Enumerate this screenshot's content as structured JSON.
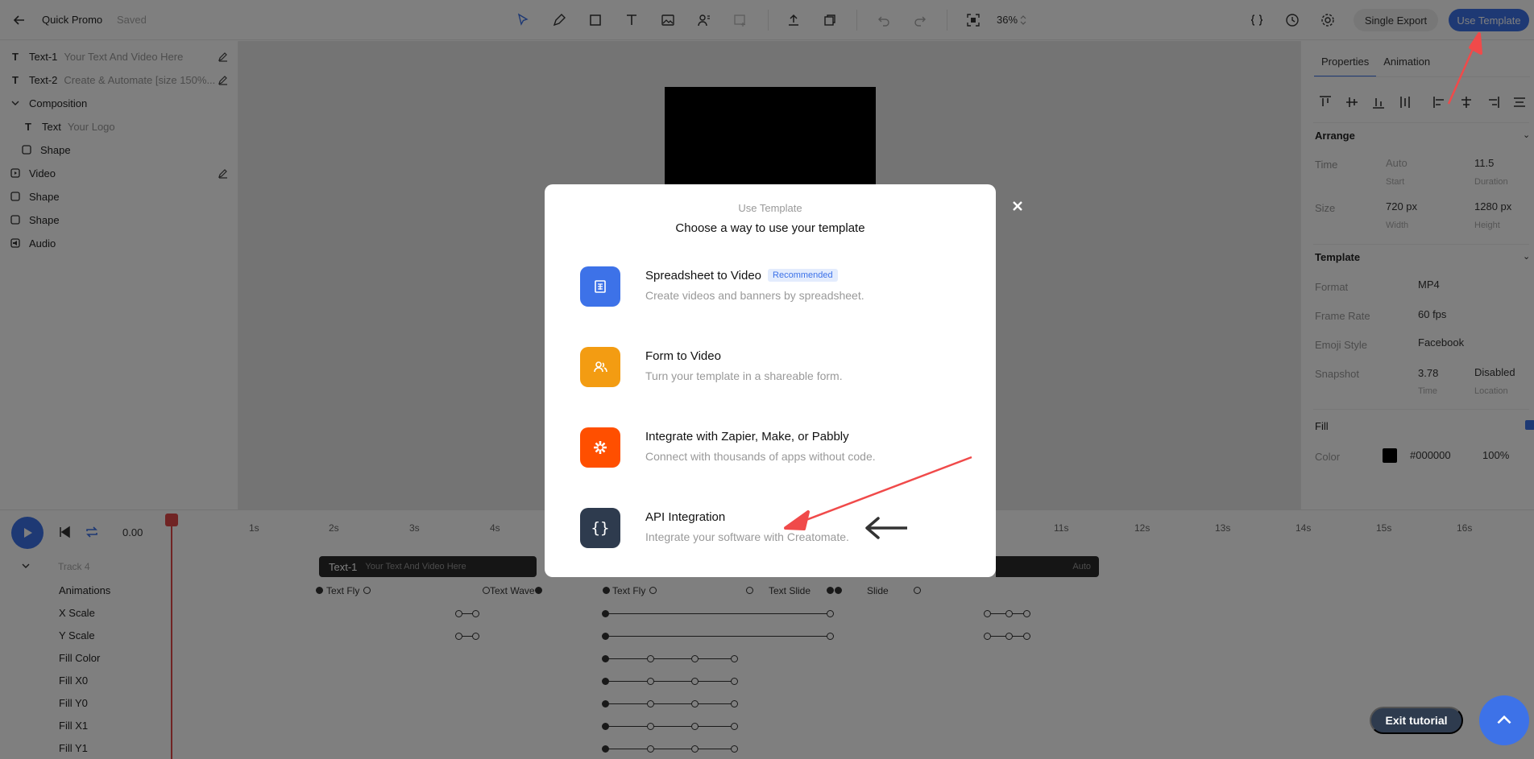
{
  "topbar": {
    "project_name": "Quick Promo",
    "saved_status": "Saved",
    "zoom": "36%",
    "single_export": "Single Export",
    "use_template": "Use Template"
  },
  "layers": [
    {
      "label": "Text-1",
      "sub": "Your Text And Video Here"
    },
    {
      "label": "Text-2",
      "sub": "Create & Automate [size 150%..."
    },
    {
      "label": "Composition",
      "sub": ""
    },
    {
      "label": "Text",
      "sub": "Your Logo"
    },
    {
      "label": "Shape",
      "sub": ""
    },
    {
      "label": "Video",
      "sub": ""
    },
    {
      "label": "Shape",
      "sub": ""
    },
    {
      "label": "Shape",
      "sub": ""
    },
    {
      "label": "Audio",
      "sub": ""
    }
  ],
  "properties": {
    "tabs": [
      "Properties",
      "Animation"
    ],
    "arrange_title": "Arrange",
    "time_label": "Time",
    "time_start": "Auto",
    "time_start_hint": "Start",
    "time_duration": "11.5",
    "time_duration_hint": "Duration",
    "size_label": "Size",
    "width": "720 px",
    "width_hint": "Width",
    "height": "1280 px",
    "height_hint": "Height",
    "template_title": "Template",
    "format_label": "Format",
    "format": "MP4",
    "framerate_label": "Frame Rate",
    "framerate": "60 fps",
    "emoji_label": "Emoji Style",
    "emoji": "Facebook",
    "snapshot_label": "Snapshot",
    "snapshot_time": "3.78",
    "snapshot_time_hint": "Time",
    "snapshot_location": "Disabled",
    "snapshot_location_hint": "Location",
    "fill_title": "Fill",
    "color_label": "Color",
    "color_hex": "#000000",
    "opacity": "100%"
  },
  "timeline": {
    "time": "0.00",
    "ticks": [
      "1s",
      "2s",
      "3s",
      "4s",
      "11s",
      "12s",
      "13s",
      "14s",
      "15s",
      "16s"
    ],
    "track_name": "Track 4",
    "clip_title": "Text-1",
    "clip_sub": "Your Text And Video Here",
    "clip2_label": "Auto",
    "rows": [
      "Animations",
      "X Scale",
      "Y Scale",
      "Fill Color",
      "Fill X0",
      "Fill Y0",
      "Fill X1",
      "Fill Y1"
    ],
    "anim_labels": [
      "Text Fly",
      "Text Wave",
      "Text Fly",
      "Text Slide",
      "Slide"
    ]
  },
  "tutorial": {
    "exit": "Exit tutorial"
  },
  "modal": {
    "kicker": "Use Template",
    "title": "Choose a way to use your template",
    "options": [
      {
        "title": "Spreadsheet to Video",
        "badge": "Recommended",
        "desc": "Create videos and banners by spreadsheet.",
        "icon": "spreadsheet-icon",
        "color": "#3d72e8"
      },
      {
        "title": "Form to Video",
        "badge": "",
        "desc": "Turn your template in a shareable form.",
        "icon": "users-icon",
        "color": "#f39c12"
      },
      {
        "title": "Integrate with Zapier, Make, or Pabbly",
        "badge": "",
        "desc": "Connect with thousands of apps without code.",
        "icon": "zapier-icon",
        "color": "#ff4f00"
      },
      {
        "title": "API Integration",
        "badge": "",
        "desc": "Integrate your software with Creatomate.",
        "icon": "code-braces-icon",
        "color": "#2e3b4e"
      }
    ]
  },
  "colors": {
    "accent": "#3d72e8",
    "annotation_arrow": "#f04a4a"
  }
}
